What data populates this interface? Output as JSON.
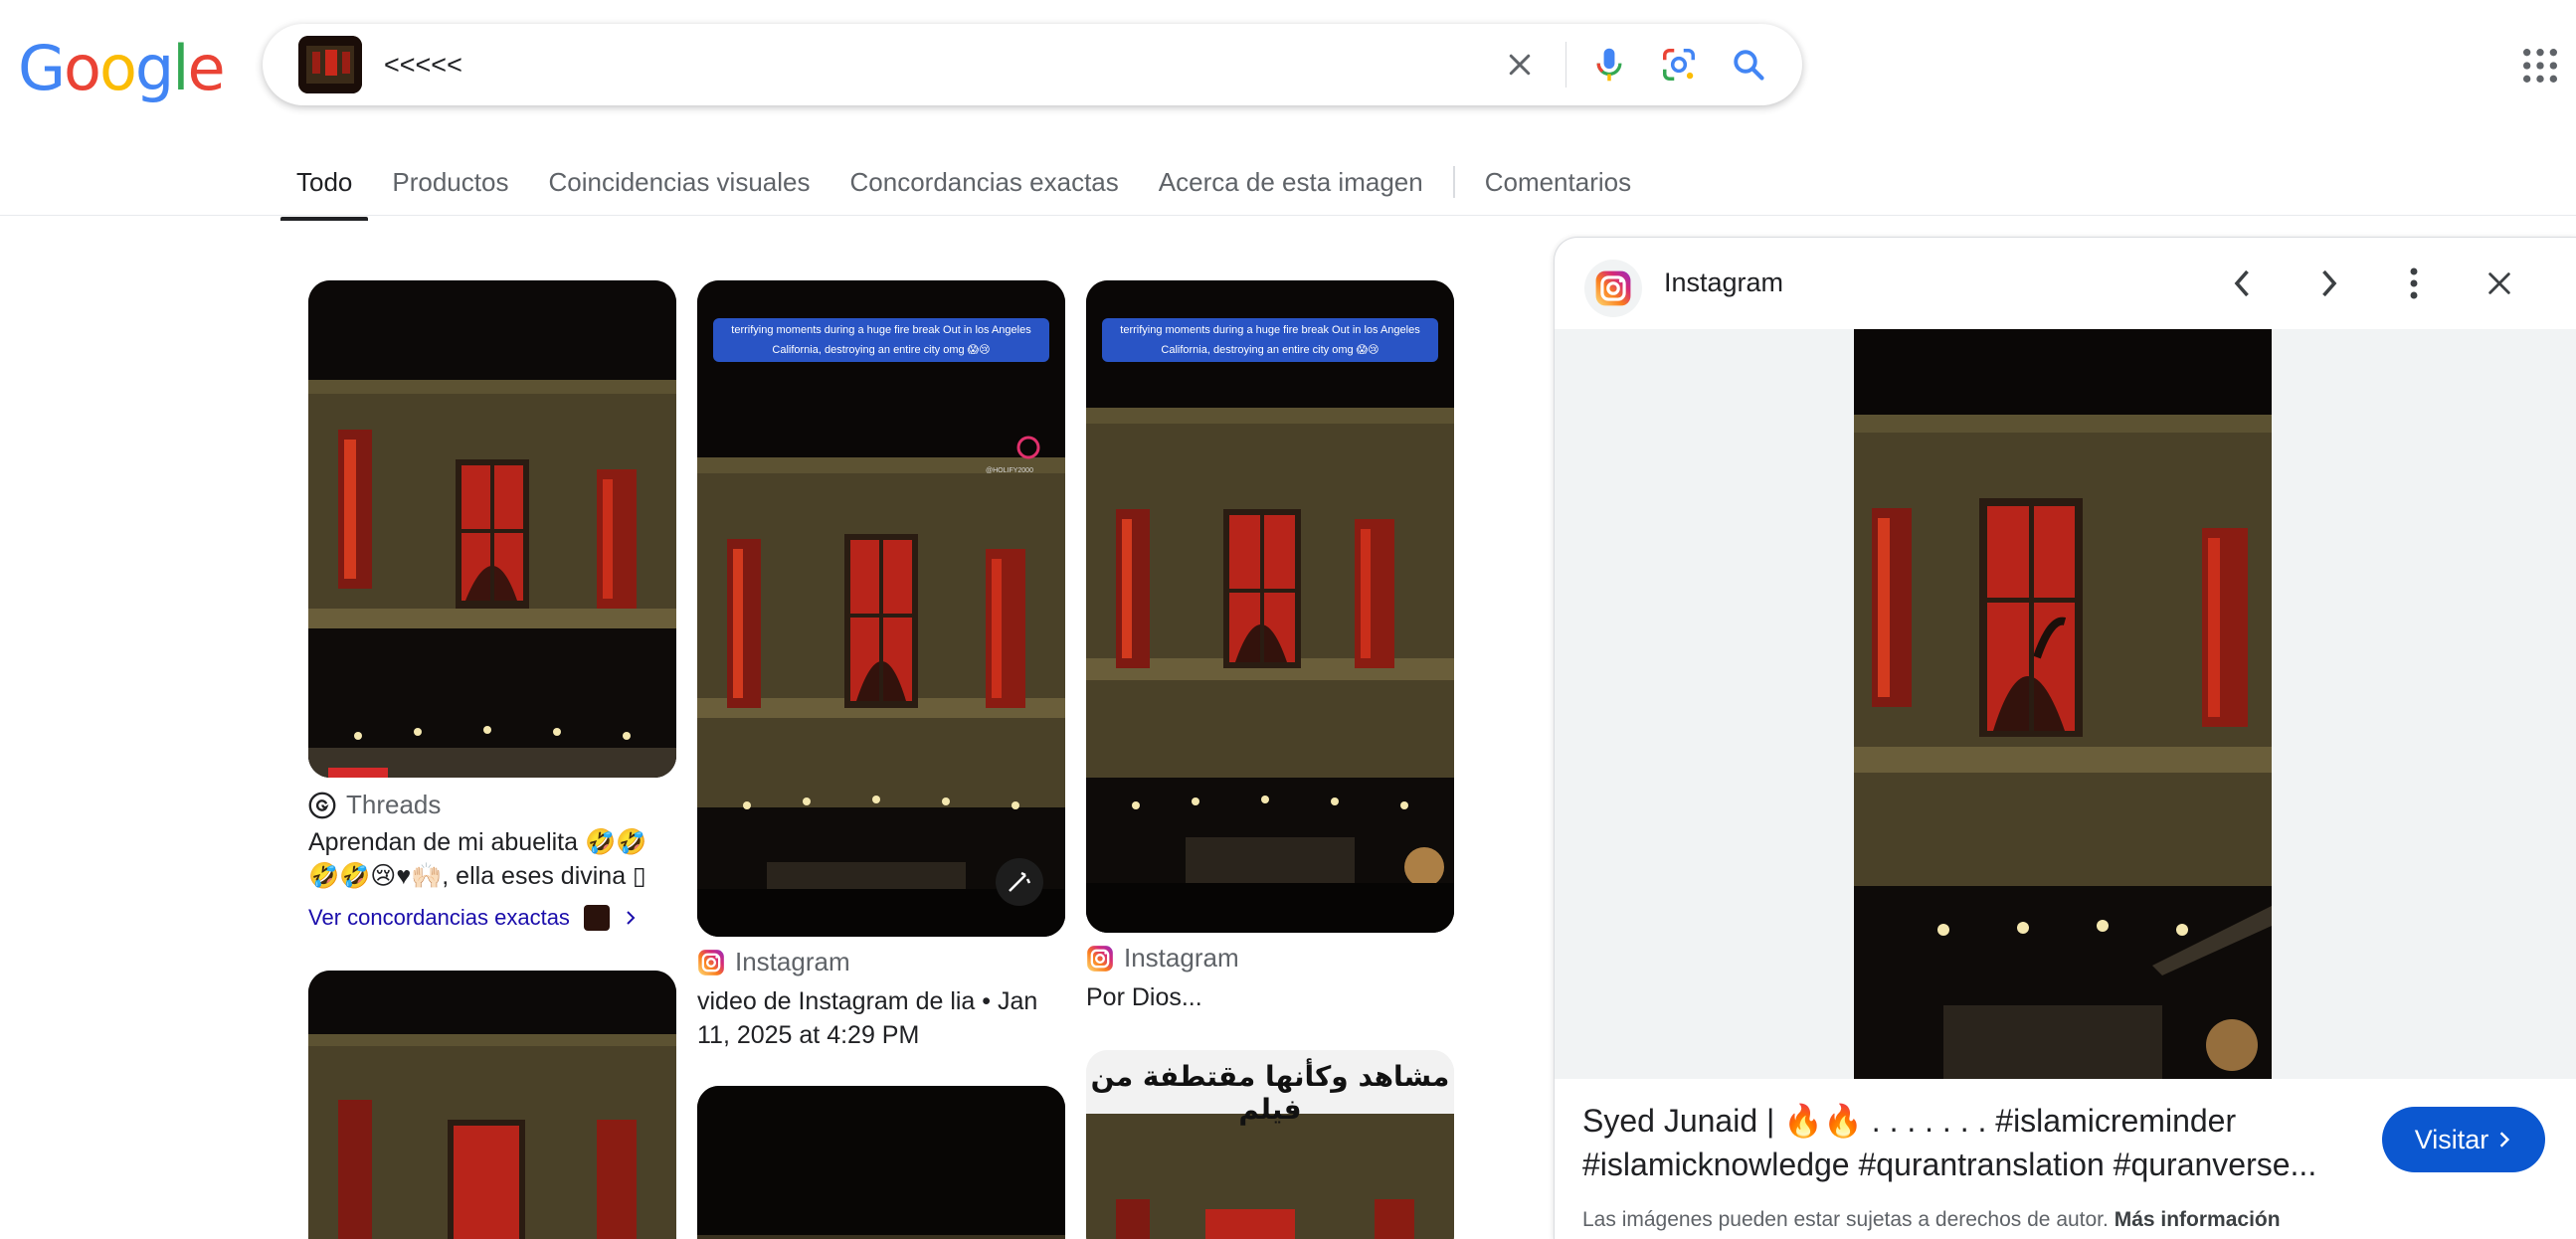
{
  "brand": {
    "logo_letters": [
      "G",
      "o",
      "o",
      "g",
      "l",
      "e"
    ],
    "logo_colors": [
      "#4285F4",
      "#EA4335",
      "#FBBC05",
      "#4285F4",
      "#34A853",
      "#EA4335"
    ]
  },
  "search": {
    "query": "<<<<<",
    "icons": [
      "close-icon",
      "microphone-icon",
      "google-lens-icon",
      "search-icon"
    ]
  },
  "tabs": [
    {
      "label": "Todo",
      "active": true
    },
    {
      "label": "Productos"
    },
    {
      "label": "Coincidencias visuales"
    },
    {
      "label": "Concordancias exactas"
    },
    {
      "label": "Acerca de esta imagen"
    },
    {
      "label": "Comentarios"
    }
  ],
  "results": [
    {
      "source": "Threads",
      "source_icon": "threads-icon",
      "description": "Aprendan de mi abuelita 🤣🤣🤣🤣😢♥🙌🏻, ella eses divina ▯❤️♥....",
      "link_label": "Ver concordancias exactas"
    },
    {
      "overlay_caption_1": "terrifying moments during a huge fire break Out in los Angeles",
      "overlay_caption_2": "California, destroying an entire city omg 😱😢",
      "watermark": "@HOLIFY2000",
      "source": "Instagram",
      "source_icon": "instagram-icon",
      "description": "video de Instagram de lia • Jan 11, 2025 at 4:29 PM"
    },
    {
      "overlay_caption_1": "terrifying moments during a huge fire break Out in los Angeles",
      "overlay_caption_2": "California, destroying an entire city omg 😱😢",
      "source": "Instagram",
      "source_icon": "instagram-icon",
      "description": "Por Dios..."
    },
    {
      "arabic_caption": "مشاهد وكأنها مقتطفة من فيلم"
    }
  ],
  "panel": {
    "source": "Instagram",
    "title": "Syed Junaid | 🔥🔥 . . . . . . . #islamicreminder #islamicknowledge #qurantranslation #quranverse...",
    "visit_label": "Visitar",
    "copyright_text": "Las imágenes pueden estar sujetas a derechos de autor.",
    "more_info_label": "Más información"
  },
  "colors": {
    "accent_blue": "#0b57d0",
    "link_blue": "#1a0dab",
    "fire_glow": "#ff4a26",
    "window_red": "#b8241a",
    "building": "#4a4128"
  }
}
